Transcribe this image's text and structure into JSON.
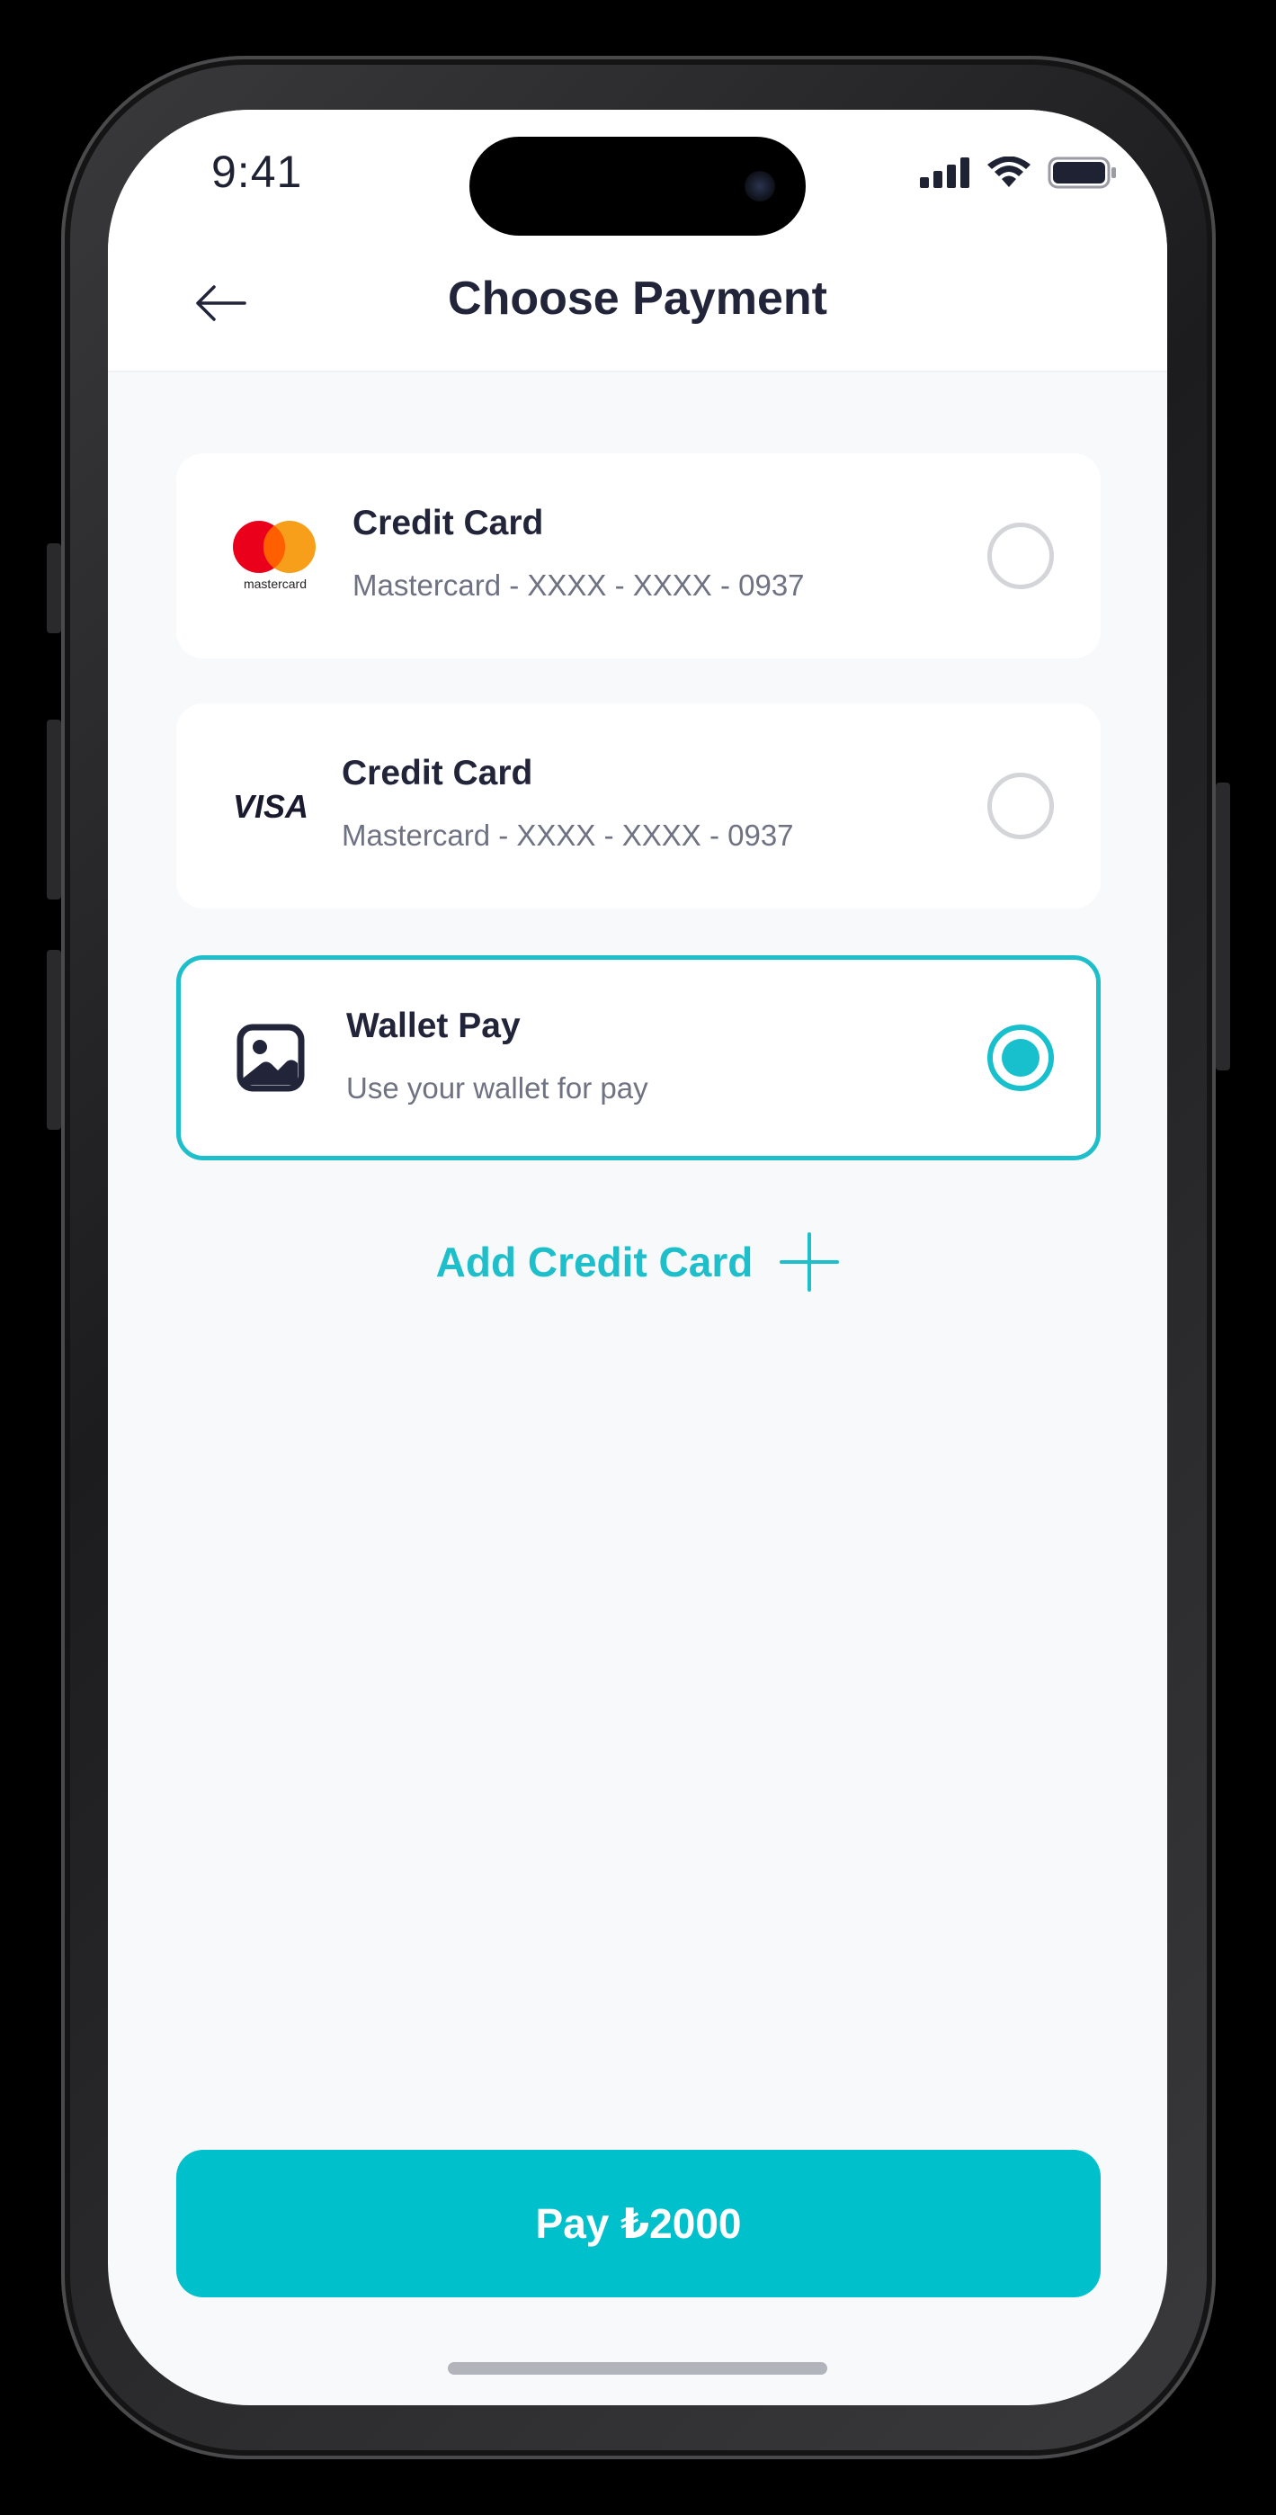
{
  "status_bar": {
    "time": "9:41",
    "icons": [
      "signal-icon",
      "wifi-icon",
      "battery-icon"
    ]
  },
  "header": {
    "title": "Choose Payment",
    "back_icon": "arrow-left-icon"
  },
  "payment_methods": [
    {
      "logo": "mastercard-logo",
      "logo_text": "mastercard",
      "title": "Credit Card",
      "subtitle": "Mastercard - XXXX - XXXX  - 0937",
      "selected": false
    },
    {
      "logo": "visa-logo",
      "logo_text": "VISA",
      "title": "Credit Card",
      "subtitle": "Mastercard - XXXX - XXXX  - 0937",
      "selected": false
    },
    {
      "logo": "wallet-image-icon",
      "title": "Wallet Pay",
      "subtitle": "Use your wallet for pay",
      "selected": true
    }
  ],
  "add_card": {
    "label": "Add Credit Card",
    "icon": "plus-icon"
  },
  "pay_button": {
    "label": "Pay ₺2000"
  },
  "colors": {
    "accent": "#00c0cc",
    "text_primary": "#22253a",
    "text_secondary": "#6e7282",
    "background": "#f8f9fa"
  }
}
